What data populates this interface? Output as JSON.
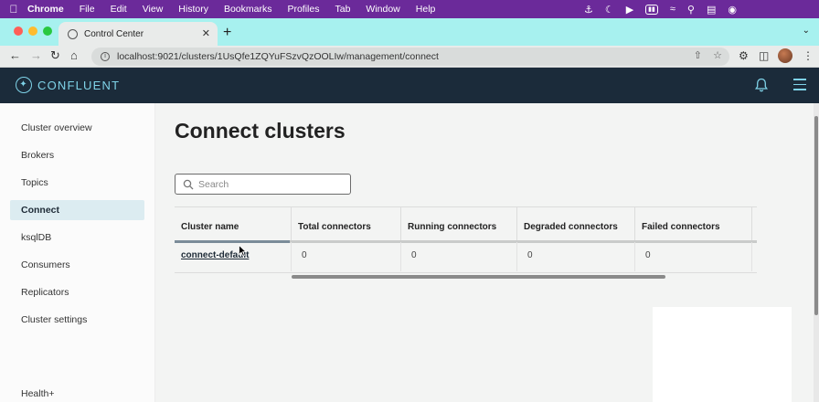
{
  "menubar": {
    "app": "Chrome",
    "items": [
      "File",
      "Edit",
      "View",
      "History",
      "Bookmarks",
      "Profiles",
      "Tab",
      "Window",
      "Help"
    ]
  },
  "browser": {
    "tab_title": "Control Center",
    "url": "localhost:9021/clusters/1UsQfe1ZQYuFSzvQzOOLIw/management/connect"
  },
  "app": {
    "logo_text": "CONFLUENT"
  },
  "sidebar": {
    "items": [
      {
        "label": "Cluster overview",
        "active": false
      },
      {
        "label": "Brokers",
        "active": false
      },
      {
        "label": "Topics",
        "active": false
      },
      {
        "label": "Connect",
        "active": true
      },
      {
        "label": "ksqlDB",
        "active": false
      },
      {
        "label": "Consumers",
        "active": false
      },
      {
        "label": "Replicators",
        "active": false
      },
      {
        "label": "Cluster settings",
        "active": false
      }
    ],
    "footer_label": "Health+"
  },
  "main": {
    "title": "Connect clusters",
    "search_placeholder": "Search",
    "table": {
      "columns": [
        "Cluster name",
        "Total connectors",
        "Running connectors",
        "Degraded connectors",
        "Failed connectors"
      ],
      "rows": [
        [
          "connect-default",
          "0",
          "0",
          "0",
          "0"
        ]
      ]
    }
  },
  "colors": {
    "menubar": "#6b2a9a",
    "tabstrip": "#a7f1ef",
    "app_header": "#1b2b3a",
    "accent": "#7fd3e8",
    "active_nav": "#dcecf1"
  }
}
